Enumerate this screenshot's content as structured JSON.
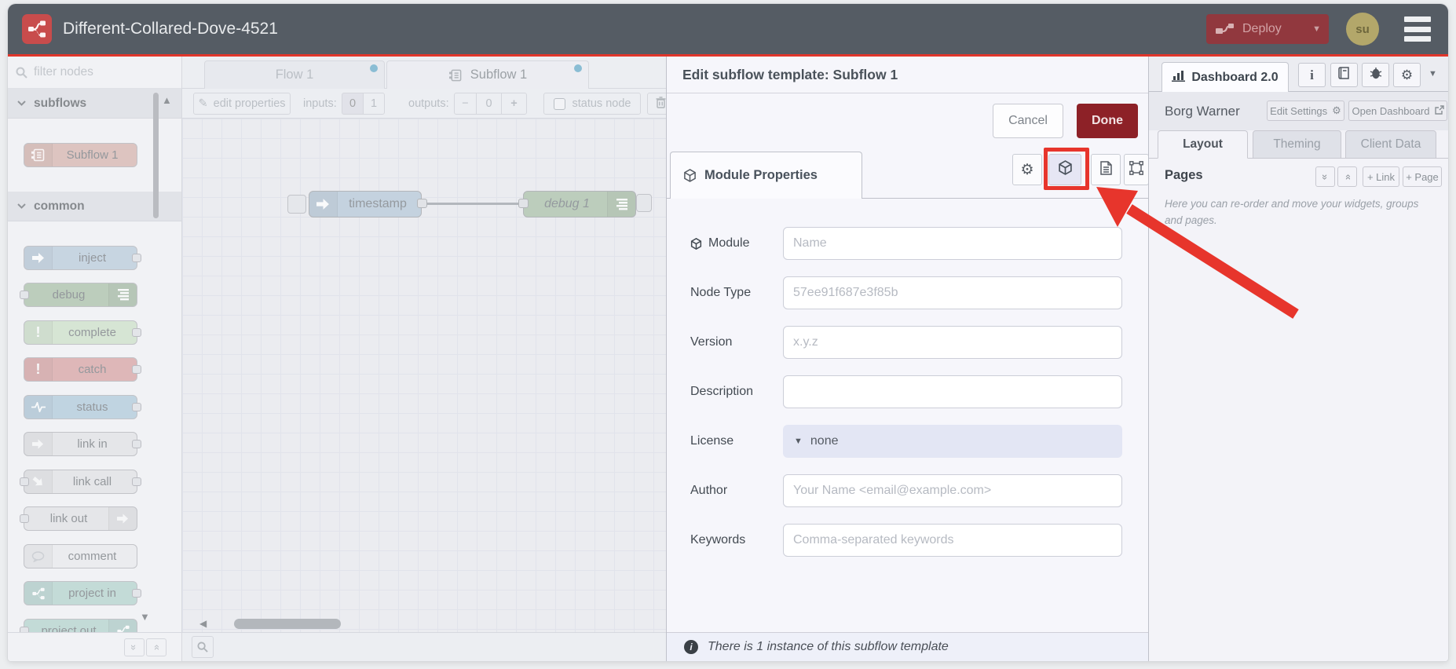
{
  "header": {
    "title": "Different-Collared-Dove-4521",
    "deploy_label": "Deploy",
    "avatar_text": "su"
  },
  "palette": {
    "filter_placeholder": "filter nodes",
    "categories": [
      {
        "label": "subflows",
        "nodes": [
          {
            "label": "Subflow 1",
            "color": "#d2a8a0"
          }
        ]
      },
      {
        "label": "common",
        "nodes": [
          {
            "label": "inject",
            "color": "#afc3d6"
          },
          {
            "label": "debug",
            "color": "#9db79a"
          },
          {
            "label": "complete",
            "color": "#c7ddc1"
          },
          {
            "label": "catch",
            "color": "#d49494"
          },
          {
            "label": "status",
            "color": "#a4c2d6"
          },
          {
            "label": "link in",
            "color": "#dfdfe2"
          },
          {
            "label": "link call",
            "color": "#dfdfe2"
          },
          {
            "label": "link out",
            "color": "#dfdfe2"
          },
          {
            "label": "comment",
            "color": "#e9e9ec"
          },
          {
            "label": "project in",
            "color": "#a8cdc6"
          },
          {
            "label": "project out",
            "color": "#a8cdc6"
          }
        ]
      }
    ]
  },
  "workspace": {
    "tabs": [
      {
        "label": "Flow 1"
      },
      {
        "label": "Subflow 1"
      }
    ],
    "toolbar": {
      "edit_properties": "edit properties",
      "inputs_label": "inputs:",
      "input_zero": "0",
      "input_one": "1",
      "outputs_label": "outputs:",
      "outputs_minus": "−",
      "outputs_value": "0",
      "outputs_plus": "+",
      "status_node_label": "status node"
    },
    "nodes": [
      {
        "label": "timestamp",
        "color": "#aabfd2"
      },
      {
        "label": "debug 1",
        "color": "#9db79a"
      }
    ]
  },
  "dialog": {
    "title": "Edit subflow template: Subflow 1",
    "cancel_label": "Cancel",
    "done_label": "Done",
    "tab_label": "Module Properties",
    "fields": [
      {
        "label": "Module",
        "placeholder": "Name"
      },
      {
        "label": "Node Type",
        "placeholder": "57ee91f687e3f85b"
      },
      {
        "label": "Version",
        "placeholder": "x.y.z"
      },
      {
        "label": "Description",
        "placeholder": ""
      },
      {
        "label": "License",
        "value": "none"
      },
      {
        "label": "Author",
        "placeholder": "Your Name <email@example.com>"
      },
      {
        "label": "Keywords",
        "placeholder": "Comma-separated keywords"
      }
    ],
    "footer_text": "There is 1 instance of this subflow template"
  },
  "sidebar": {
    "tab_label": "Dashboard 2.0",
    "instance_name": "Borg Warner",
    "edit_settings_label": "Edit Settings",
    "open_dashboard_label": "Open Dashboard",
    "tabs": [
      {
        "label": "Layout"
      },
      {
        "label": "Theming"
      },
      {
        "label": "Client Data"
      }
    ],
    "pages_label": "Pages",
    "link_button": "+ Link",
    "page_button": "+ Page",
    "help_text": "Here you can re-order and move your widgets, groups and pages."
  },
  "colors": {
    "accent_red": "#e7352c",
    "header_bg": "#555c64",
    "deploy_bg": "#91383e",
    "done_bg": "#8d2127",
    "tab_dot": "#4d9dc0"
  }
}
